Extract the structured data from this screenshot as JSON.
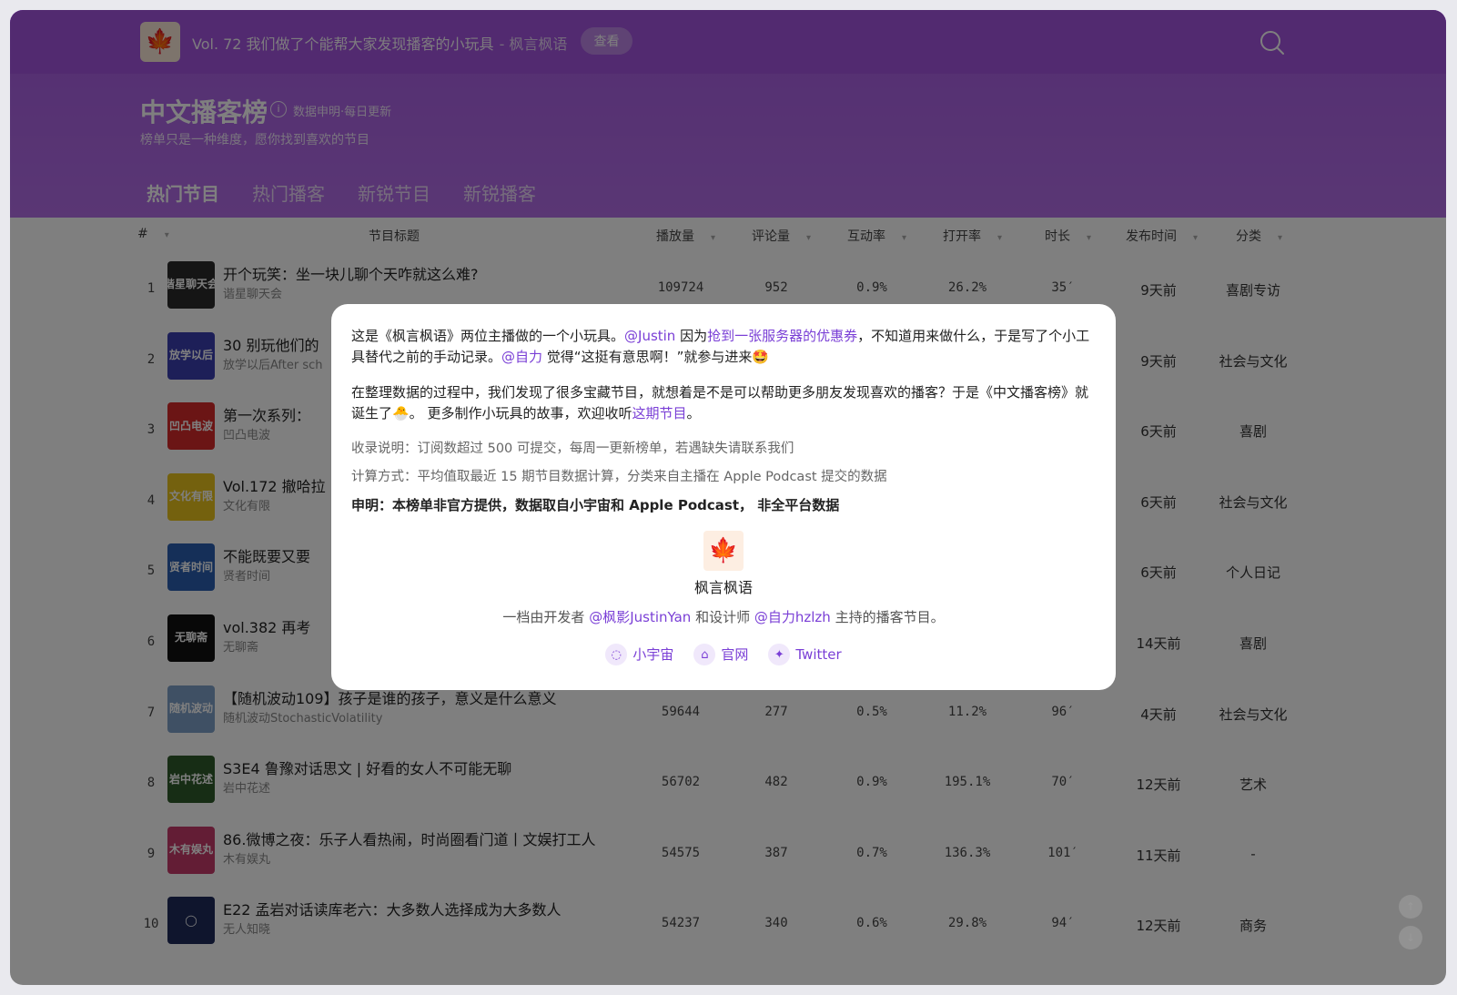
{
  "topbar": {
    "title": "Vol. 72 我们做了个能帮大家发现播客的小玩具",
    "source": "- 枫言枫语",
    "view_label": "查看"
  },
  "header": {
    "title": "中文播客榜",
    "update_note": "数据申明·每日更新",
    "subtitle": "榜单只是一种维度，愿你找到喜欢的节目",
    "tabs": [
      "热门节目",
      "热门播客",
      "新锐节目",
      "新锐播客"
    ]
  },
  "table": {
    "columns": [
      "#",
      "节目标题",
      "播放量",
      "评论量",
      "互动率",
      "打开率",
      "时长",
      "发布时间",
      "分类"
    ],
    "rows": [
      {
        "rank": "1",
        "title": "开个玩笑：坐一块儿聊个天咋就这么难?",
        "podcast": "谐星聊天会",
        "plays": "109724",
        "comments": "952",
        "interaction": "0.9%",
        "open_rate": "26.2%",
        "duration": "35′",
        "date": "9天前",
        "category": "喜剧专访",
        "cover_text": "谐星聊天会",
        "cover_color": "#2a2a2a"
      },
      {
        "rank": "2",
        "title": "30 别玩他们的",
        "podcast": "放学以后After sch",
        "plays": "",
        "comments": "",
        "interaction": "",
        "open_rate": "",
        "duration": "",
        "date": "9天前",
        "category": "社会与文化",
        "cover_text": "放学以后",
        "cover_color": "#3b3fb0"
      },
      {
        "rank": "3",
        "title": "第一次系列：",
        "podcast": "凹凸电波",
        "plays": "",
        "comments": "",
        "interaction": "",
        "open_rate": "",
        "duration": "",
        "date": "6天前",
        "category": "喜剧",
        "cover_text": "凹凸电波",
        "cover_color": "#d62a2a"
      },
      {
        "rank": "4",
        "title": "Vol.172 撤哈拉",
        "podcast": "文化有限",
        "plays": "",
        "comments": "",
        "interaction": "",
        "open_rate": "",
        "duration": "",
        "date": "6天前",
        "category": "社会与文化",
        "cover_text": "文化有限",
        "cover_color": "#e8c31c"
      },
      {
        "rank": "5",
        "title": "不能既要又要",
        "podcast": "贤者时间",
        "plays": "",
        "comments": "",
        "interaction": "",
        "open_rate": "",
        "duration": "",
        "date": "6天前",
        "category": "个人日记",
        "cover_text": "贤者时间",
        "cover_color": "#2a5fb0"
      },
      {
        "rank": "6",
        "title": "vol.382 再考",
        "podcast": "无聊斋",
        "plays": "",
        "comments": "",
        "interaction": "",
        "open_rate": "",
        "duration": "",
        "date": "14天前",
        "category": "喜剧",
        "cover_text": "无聊斋",
        "cover_color": "#111111"
      },
      {
        "rank": "7",
        "title": "【随机波动109】孩子是谁的孩子，意义是什么意义",
        "podcast": "随机波动StochasticVolatility",
        "plays": "59644",
        "comments": "277",
        "interaction": "0.5%",
        "open_rate": "11.2%",
        "duration": "96′",
        "date": "4天前",
        "category": "社会与文化",
        "cover_text": "随机波动",
        "cover_color": "#7fa0c8"
      },
      {
        "rank": "8",
        "title": "S3E4 鲁豫对话思文 | 好看的女人不可能无聊",
        "podcast": "岩中花述",
        "plays": "56702",
        "comments": "482",
        "interaction": "0.9%",
        "open_rate": "195.1%",
        "duration": "70′",
        "date": "12天前",
        "category": "艺术",
        "cover_text": "岩中花述",
        "cover_color": "#2f5a2a"
      },
      {
        "rank": "9",
        "title": "86.微博之夜：乐子人看热闹，时尚圈看门道丨文娱打工人",
        "podcast": "木有娱丸",
        "plays": "54575",
        "comments": "387",
        "interaction": "0.7%",
        "open_rate": "136.3%",
        "duration": "101′",
        "date": "11天前",
        "category": "-",
        "cover_text": "木有娱丸",
        "cover_color": "#c63a6a"
      },
      {
        "rank": "10",
        "title": "E22 孟岩对话读库老六：大多数人选择成为大多数人",
        "podcast": "无人知晓",
        "plays": "54237",
        "comments": "340",
        "interaction": "0.6%",
        "open_rate": "29.8%",
        "duration": "94′",
        "date": "12天前",
        "category": "商务",
        "cover_text": "◯",
        "cover_color": "#1f2a5a"
      }
    ]
  },
  "modal": {
    "p1_a": "这是《枫言枫语》两位主播做的一个小玩具。",
    "p1_justin": "@Justin",
    "p1_b": " 因为",
    "p1_coupon": "抢到一张服务器的优惠券",
    "p1_c": "，不知道用来做什么，于是写了个小工具替代之前的手动记录。",
    "p1_zili": "@自力",
    "p1_d": " 觉得“这挺有意思啊！”就参与进来🤩",
    "p2_a": "在整理数据的过程中，我们发现了很多宝藏节目，就想着是不是可以帮助更多朋友发现喜欢的播客？于是《中文播客榜》就诞生了🐣。 更多制作小玩具的故事，欢迎收听",
    "p2_link": "这期节目",
    "p2_b": "。",
    "note1": "收录说明：订阅数超过 500 可提交，每周一更新榜单，若遇缺失请联系我们",
    "note2": "计算方式：平均值取最近 15 期节目数据计算，分类来自主播在 Apple Podcast 提交的数据",
    "declaration": "申明：本榜单非官方提供，数据取自小宇宙和 Apple Podcast， 非全平台数据",
    "podcast_name": "枫言枫语",
    "desc_a": "一档由开发者 ",
    "desc_dev": "@枫影JustinYan",
    "desc_b": " 和设计师 ",
    "desc_designer": "@自力hzlzh",
    "desc_c": " 主持的播客节目。",
    "links": [
      "小宇宙",
      "官网",
      "Twitter"
    ]
  },
  "colors": {
    "header": "#a85de4",
    "accent": "#7a3fd6"
  }
}
